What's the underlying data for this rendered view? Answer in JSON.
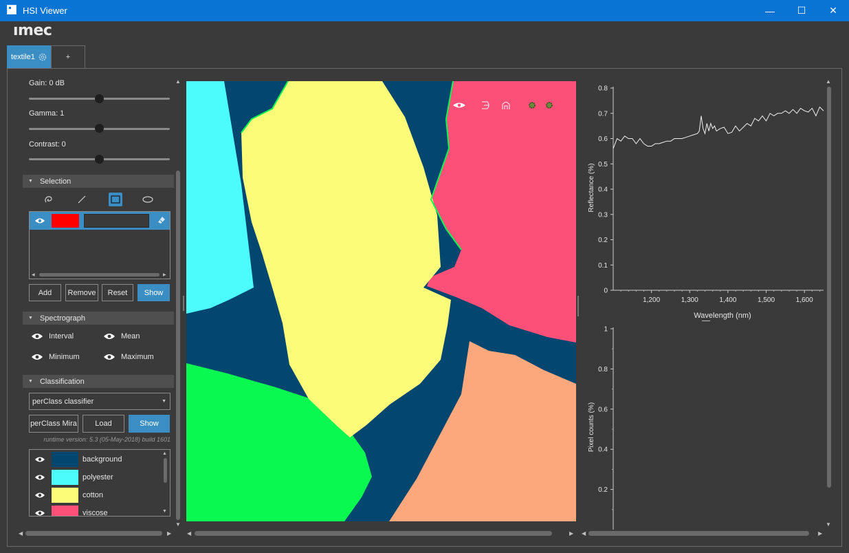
{
  "window": {
    "title": "HSI Viewer",
    "minimize": "—",
    "maximize": "☐",
    "close": "✕"
  },
  "logo": "ımec",
  "tabs": [
    {
      "label": "textile1"
    },
    {
      "label": "+"
    }
  ],
  "sliders": {
    "gain": {
      "label": "Gain: 0 dB",
      "value": 0.5
    },
    "gamma": {
      "label": "Gamma: 1",
      "value": 0.5
    },
    "contrast": {
      "label": "Contrast: 0",
      "value": 0.5
    }
  },
  "selection": {
    "header": "Selection",
    "tools": [
      "lasso-icon",
      "line-icon",
      "rectangle-icon",
      "ellipse-icon"
    ],
    "active_tool": "rectangle-icon",
    "item_color": "#ff0000",
    "buttons": {
      "add": "Add",
      "remove": "Remove",
      "reset": "Reset",
      "show": "Show"
    }
  },
  "spectrograph": {
    "header": "Spectrograph",
    "options": {
      "interval": "Interval",
      "mean": "Mean",
      "minimum": "Minimum",
      "maximum": "Maximum"
    }
  },
  "classification": {
    "header": "Classification",
    "classifier": "perClass classifier",
    "buttons": {
      "mira": "perClass Mira",
      "load": "Load",
      "show": "Show"
    },
    "runtime": "runtime version: 5.3 (05-May-2018) build 1601",
    "classes": [
      {
        "name": "background",
        "color": "#034670"
      },
      {
        "name": "polyester",
        "color": "#4cfcfc"
      },
      {
        "name": "cotton",
        "color": "#fcfc78"
      },
      {
        "name": "viscose",
        "color": "#fc5078"
      }
    ]
  },
  "image_toolbar": [
    "eye-icon",
    "brush-icon",
    "eraser-icon",
    "gear-icon",
    "gear-icon"
  ],
  "colors": {
    "accent": "#3b8ec4",
    "green_class": "#0af950",
    "orange_class": "#fca87c"
  },
  "chart_data": [
    {
      "type": "line",
      "xlabel": "Wavelength (nm)",
      "ylabel": "Reflectance (%)",
      "xlim": [
        1100,
        1650
      ],
      "ylim": [
        0,
        0.8
      ],
      "xticks": [
        "1,200",
        "1,300",
        "1,400",
        "1,500",
        "1,600"
      ],
      "yticks": [
        "0",
        "0.1",
        "0.2",
        "0.3",
        "0.4",
        "0.5",
        "0.6",
        "0.7",
        "0.8"
      ],
      "x": [
        1100,
        1110,
        1120,
        1130,
        1140,
        1150,
        1160,
        1170,
        1180,
        1190,
        1200,
        1210,
        1220,
        1230,
        1240,
        1250,
        1260,
        1270,
        1280,
        1290,
        1300,
        1310,
        1320,
        1325,
        1330,
        1335,
        1340,
        1345,
        1350,
        1355,
        1360,
        1365,
        1370,
        1380,
        1390,
        1400,
        1410,
        1420,
        1430,
        1440,
        1450,
        1460,
        1470,
        1480,
        1490,
        1500,
        1510,
        1520,
        1530,
        1540,
        1550,
        1560,
        1570,
        1580,
        1590,
        1600,
        1610,
        1620,
        1630,
        1640,
        1650
      ],
      "y": [
        0.56,
        0.6,
        0.59,
        0.61,
        0.6,
        0.6,
        0.58,
        0.6,
        0.58,
        0.57,
        0.57,
        0.58,
        0.58,
        0.585,
        0.59,
        0.59,
        0.6,
        0.6,
        0.6,
        0.605,
        0.61,
        0.615,
        0.62,
        0.63,
        0.69,
        0.64,
        0.62,
        0.66,
        0.63,
        0.66,
        0.64,
        0.65,
        0.63,
        0.64,
        0.645,
        0.62,
        0.625,
        0.65,
        0.63,
        0.645,
        0.66,
        0.65,
        0.68,
        0.67,
        0.69,
        0.67,
        0.7,
        0.69,
        0.7,
        0.7,
        0.71,
        0.7,
        0.715,
        0.7,
        0.72,
        0.71,
        0.705,
        0.72,
        0.69,
        0.725,
        0.71
      ]
    },
    {
      "type": "bar",
      "ylabel": "Pixel counts (%)",
      "ylim": [
        0,
        1
      ],
      "yticks": [
        "1",
        "0.8",
        "0.6",
        "0.4",
        "0.2"
      ],
      "values": []
    }
  ]
}
